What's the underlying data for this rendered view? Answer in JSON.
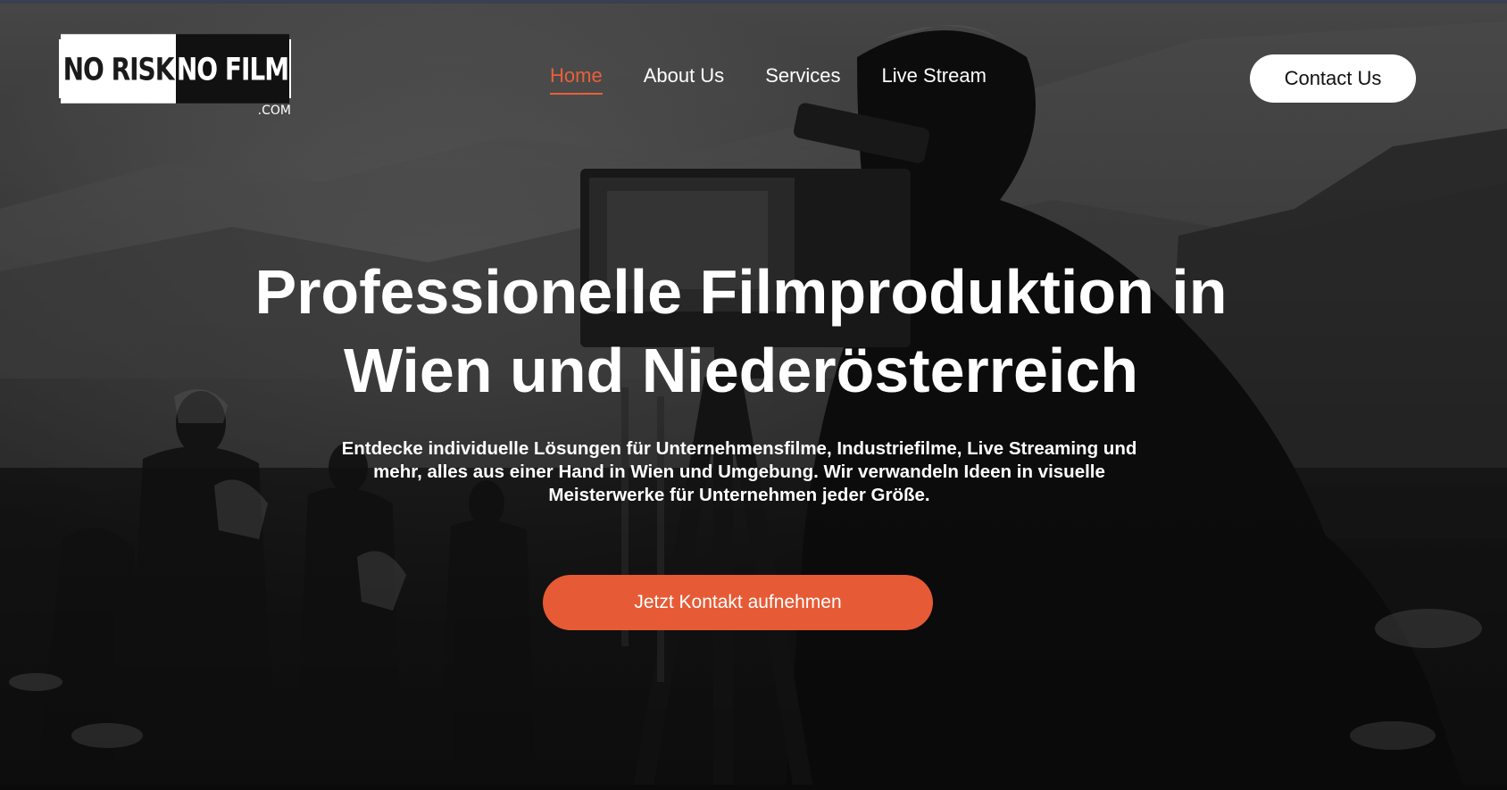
{
  "brand": {
    "logo_left": "NO RISK",
    "logo_right": "NO FILM",
    "logo_suffix": ".COM"
  },
  "nav": {
    "items": [
      {
        "label": "Home",
        "active": true
      },
      {
        "label": "About Us",
        "active": false
      },
      {
        "label": "Services",
        "active": false
      },
      {
        "label": "Live Stream",
        "active": false
      }
    ],
    "contact_label": "Contact Us"
  },
  "hero": {
    "title_line1": "Professionelle Filmproduktion in",
    "title_line2": "Wien und Niederösterreich",
    "description_line1": "Entdecke individuelle Lösungen für Unternehmensfilme, Industriefilme, Live Streaming und",
    "description_line2": "mehr, alles aus einer Hand in Wien und Umgebung. Wir verwandeln Ideen in visuelle",
    "description_line3": "Meisterwerke für Unternehmen jeder Größe.",
    "cta_label": "Jetzt Kontakt aufnehmen"
  },
  "colors": {
    "accent": "#e65a35",
    "nav_active": "#e9603a",
    "text": "#ffffff",
    "button_light": "#ffffff"
  }
}
